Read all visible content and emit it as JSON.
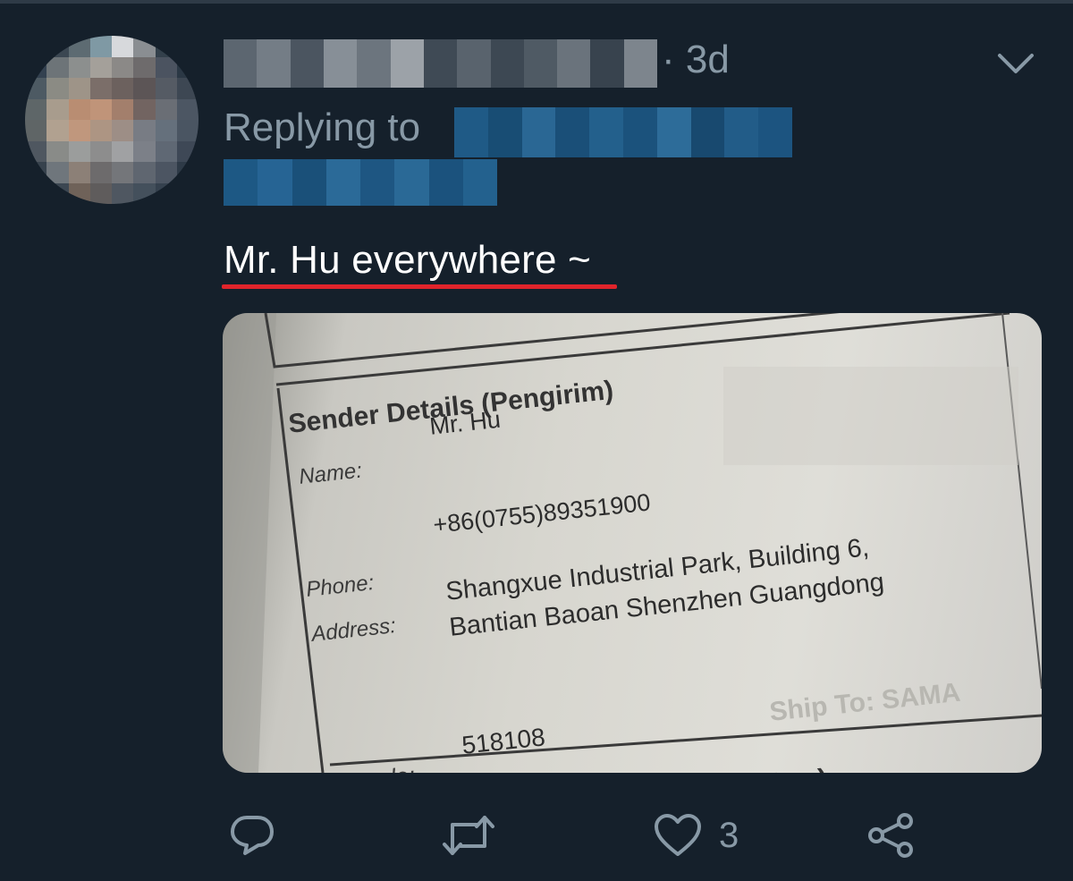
{
  "tweet": {
    "timestamp": "· 3d",
    "replying_label": "Replying to",
    "text": "Mr. Hu everywhere ~",
    "like_count": "3"
  },
  "photo": {
    "header": "Sender Details (Pengirim)",
    "name_label": "Name:",
    "name_value": "Mr. Hu",
    "phone_label": "Phone:",
    "phone_value": "+86(0755)89351900",
    "address_label": "Address:",
    "address_line1": "Shangxue Industrial Park, Building 6,",
    "address_line2": "Bantian Baoan Shenzhen Guangdong",
    "postcode_label": "stcode:",
    "postcode_value": "518108",
    "bottom_fragment": "(Penerima)",
    "faint_fragment": "Ship To: SAMA"
  },
  "colors": {
    "background": "#15202b",
    "secondary_text": "#8899a6",
    "underline_red": "#e0242b",
    "blurred_blue": "#1e5f8c"
  },
  "icons": [
    "chevron-down-icon",
    "reply-icon",
    "retweet-icon",
    "like-icon",
    "share-icon"
  ]
}
